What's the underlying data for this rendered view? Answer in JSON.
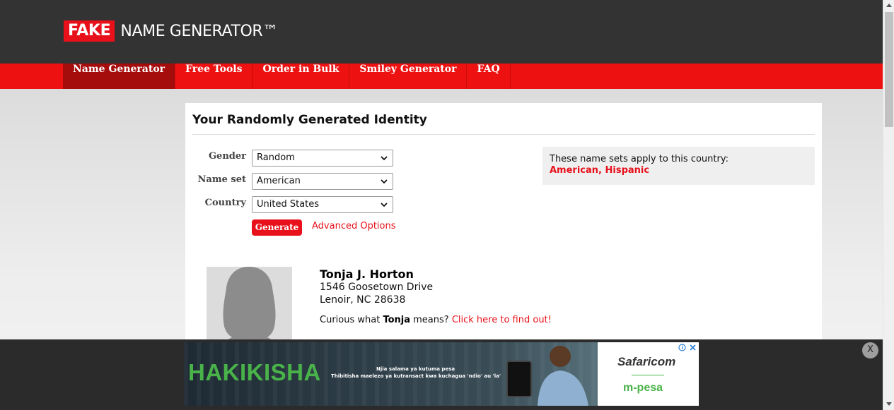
{
  "logo": {
    "fake": "FAKE",
    "rest": "NAME GENERATOR™"
  },
  "nav": {
    "items": [
      {
        "label": "Name Generator",
        "active": true
      },
      {
        "label": "Free Tools"
      },
      {
        "label": "Order in Bulk"
      },
      {
        "label": "Smiley Generator"
      },
      {
        "label": "FAQ"
      }
    ]
  },
  "main": {
    "title": "Your Randomly Generated Identity",
    "form": {
      "gender_label": "Gender",
      "gender_value": "Random",
      "nameset_label": "Name set",
      "nameset_value": "American",
      "country_label": "Country",
      "country_value": "United States",
      "generate_label": "Generate",
      "advanced_label": "Advanced Options"
    },
    "nameset_box": {
      "text": "These name sets apply to this country:",
      "link1": "American",
      "separator": ", ",
      "link2": "Hispanic"
    },
    "identity": {
      "name": "Tonja J. Horton",
      "address_line1": "1546 Goosetown Drive",
      "address_line2": "Lenoir, NC 28638",
      "curious_prefix": "Curious what ",
      "first_name": "Tonja",
      "curious_suffix": " means? ",
      "curious_link": "Click here to find out!"
    }
  },
  "ad": {
    "headline": "HAKIKISHA",
    "line1": "Njia salama ya kutuma pesa",
    "line2": "Thibitisha maelezo ya kutransact kwa kuchagua 'ndio' au 'la'",
    "brand": "Safaricom",
    "product": "m-pesa",
    "close_label": "X"
  },
  "colors": {
    "accent": "#e8101a",
    "header_bg": "#333333",
    "nav_bg": "#ee1111",
    "nav_active": "#a50c0c",
    "ad_green": "#49b34a"
  },
  "icons": [
    "chevron-down-icon",
    "adchoices-icon",
    "close-icon",
    "avatar-silhouette-icon"
  ]
}
